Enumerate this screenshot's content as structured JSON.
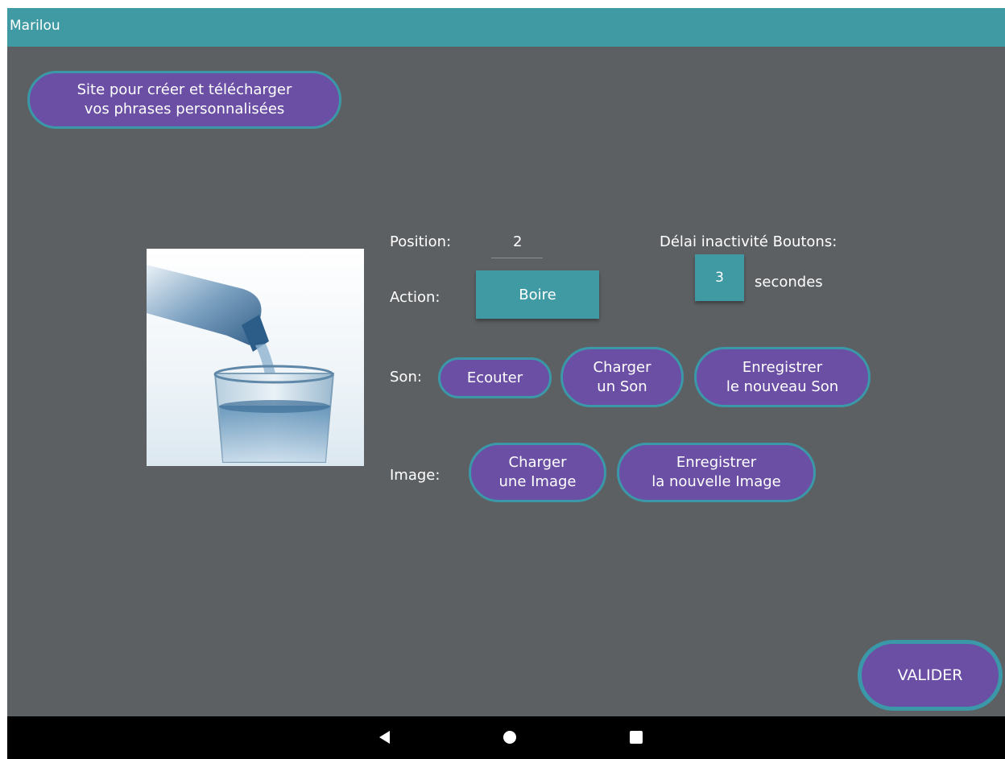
{
  "app": {
    "title": "Marilou"
  },
  "site_button": {
    "label": "Site pour créer et télécharger\nvos phrases personnalisées"
  },
  "image": {
    "description_icon": "water-glass-image"
  },
  "position": {
    "label": "Position:",
    "value": "2"
  },
  "delay": {
    "label": "Délai inactivité Boutons:",
    "value": "3",
    "unit": "secondes"
  },
  "action": {
    "label": "Action:",
    "value": "Boire"
  },
  "sound": {
    "label": "Son:",
    "listen": "Ecouter",
    "load": "Charger\nun Son",
    "record": "Enregistrer\nle nouveau Son"
  },
  "picture": {
    "label": "Image:",
    "load": "Charger\nune Image",
    "record": "Enregistrer\nla nouvelle Image"
  },
  "validate": {
    "label": "VALIDER"
  },
  "nav": {
    "back": "back-icon",
    "home": "home-icon",
    "recents": "recents-icon"
  },
  "colors": {
    "teal": "#3f9aa3",
    "purple": "#6a4fa5",
    "background": "#5d6063"
  }
}
